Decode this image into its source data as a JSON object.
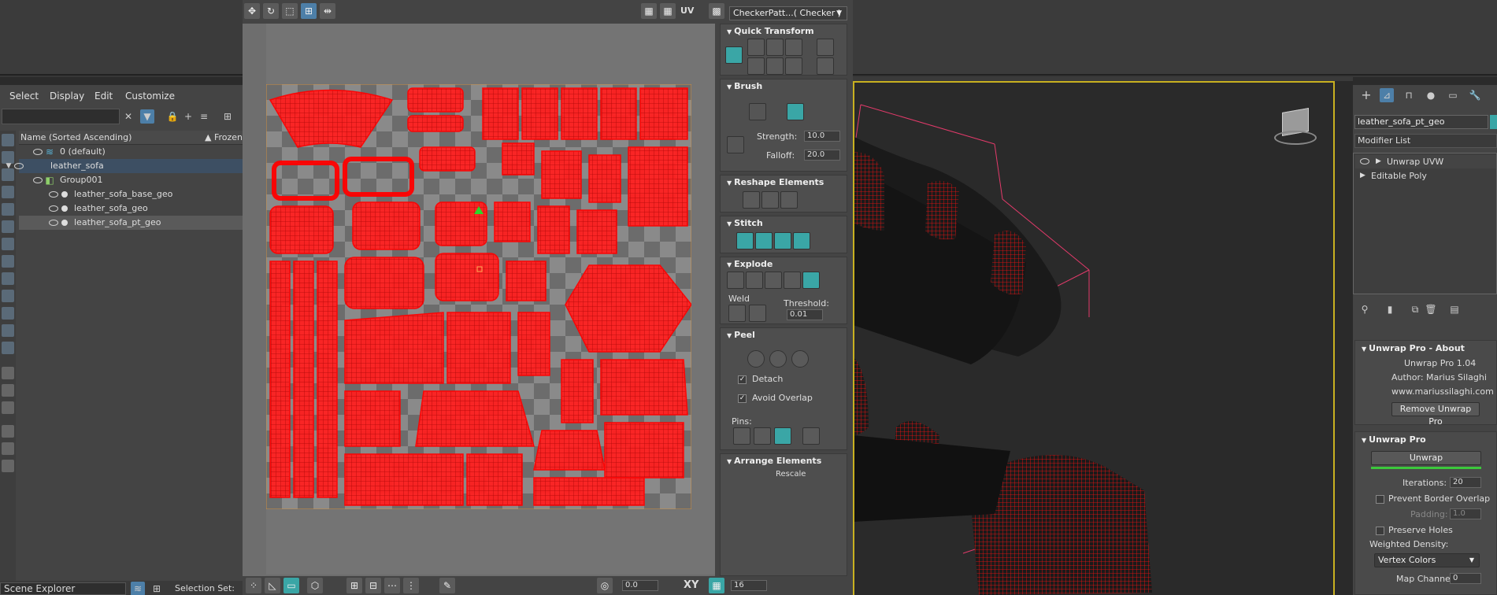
{
  "uv_editor": {
    "checker_dropdown": "CheckerPatt...( Checker )",
    "uv_label": "UV",
    "bottom": {
      "value_left": "0.0",
      "xy_label": "XY",
      "value_right": "16"
    }
  },
  "rollouts": {
    "quick_transform": "Quick Transform",
    "brush": "Brush",
    "strength_label": "Strength:",
    "strength_value": "10.0",
    "falloff_label": "Falloff:",
    "falloff_value": "20.0",
    "reshape_elements": "Reshape Elements",
    "stitch": "Stitch",
    "explode": "Explode",
    "weld_label": "Weld",
    "threshold_label": "Threshold:",
    "threshold_value": "0.01",
    "peel": "Peel",
    "detach_label": "Detach",
    "avoid_overlap_label": "Avoid Overlap",
    "pins_label": "Pins:",
    "arrange_elements": "Arrange Elements",
    "rescale_label": "Rescale"
  },
  "scene_explorer": {
    "menu": [
      "Select",
      "Display",
      "Edit",
      "Customize"
    ],
    "header_name": "Name (Sorted Ascending)",
    "header_frozen": "▲ Frozen",
    "rows": [
      "0 (default)",
      "leather_sofa",
      "Group001",
      "leather_sofa_base_geo",
      "leather_sofa_geo",
      "leather_sofa_pt_geo"
    ],
    "bottom_label": "Scene Explorer",
    "selection_set_label": "Selection Set:"
  },
  "command_panel": {
    "object_name": "leather_sofa_pt_geo",
    "modifier_list": "Modifier List",
    "stack": [
      "Unwrap UVW",
      "Editable Poly"
    ],
    "about": {
      "title": "Unwrap Pro - About",
      "version": "Unwrap Pro 1.04",
      "author": "Author: Marius Silaghi",
      "website": "www.mariussilaghi.com",
      "remove_button": "Remove Unwrap Pro"
    },
    "unwrap_pro": {
      "title": "Unwrap Pro",
      "unwrap_button": "Unwrap",
      "iterations_label": "Iterations:",
      "iterations_value": "20",
      "prevent_border_overlap": "Prevent Border Overlap",
      "padding_label": "Padding:",
      "padding_value": "1.0",
      "preserve_holes": "Preserve Holes",
      "weighted_density_label": "Weighted Density:",
      "weighted_density_value": "Vertex Colors",
      "map_channel_label": "Map Channel:",
      "map_channel_value": "0"
    }
  },
  "colors": {
    "uv_island": "#ff1a1a",
    "selection_frame": "#c8b020",
    "accent_teal": "#3aa6a6",
    "progress_green": "#3cc83c"
  }
}
